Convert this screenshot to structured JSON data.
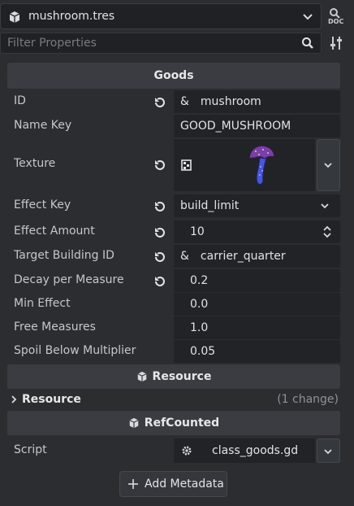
{
  "header": {
    "resource_name": "mushroom.tres",
    "doc_label": "DOC",
    "filter_placeholder": "Filter Properties"
  },
  "sections": {
    "goods": "Goods",
    "resource": "Resource",
    "refcounted": "RefCounted"
  },
  "properties": {
    "id": {
      "label": "ID",
      "value": "mushroom",
      "prefix": "&"
    },
    "name_key": {
      "label": "Name Key",
      "value": "GOOD_MUSHROOM"
    },
    "texture": {
      "label": "Texture"
    },
    "effect_key": {
      "label": "Effect Key",
      "value": "build_limit"
    },
    "effect_amount": {
      "label": "Effect Amount",
      "value": "10"
    },
    "target_building_id": {
      "label": "Target Building ID",
      "value": "carrier_quarter",
      "prefix": "&"
    },
    "decay_per_measure": {
      "label": "Decay per Measure",
      "value": "0.2"
    },
    "min_effect": {
      "label": "Min Effect",
      "value": "0.0"
    },
    "free_measures": {
      "label": "Free Measures",
      "value": "1.0"
    },
    "spoil_below_multiplier": {
      "label": "Spoil Below Multiplier",
      "value": "0.05"
    }
  },
  "resource_group": {
    "label": "Resource",
    "changes": "(1 change)"
  },
  "script": {
    "label": "Script",
    "value": "class_goods.gd"
  },
  "add_metadata": "Add Metadata",
  "colors": {
    "background": "#2b2d31",
    "field": "#212327",
    "section": "#3a3c41",
    "mushroom_cap": "#7b3fa8",
    "mushroom_stem": "#4a57d6"
  }
}
